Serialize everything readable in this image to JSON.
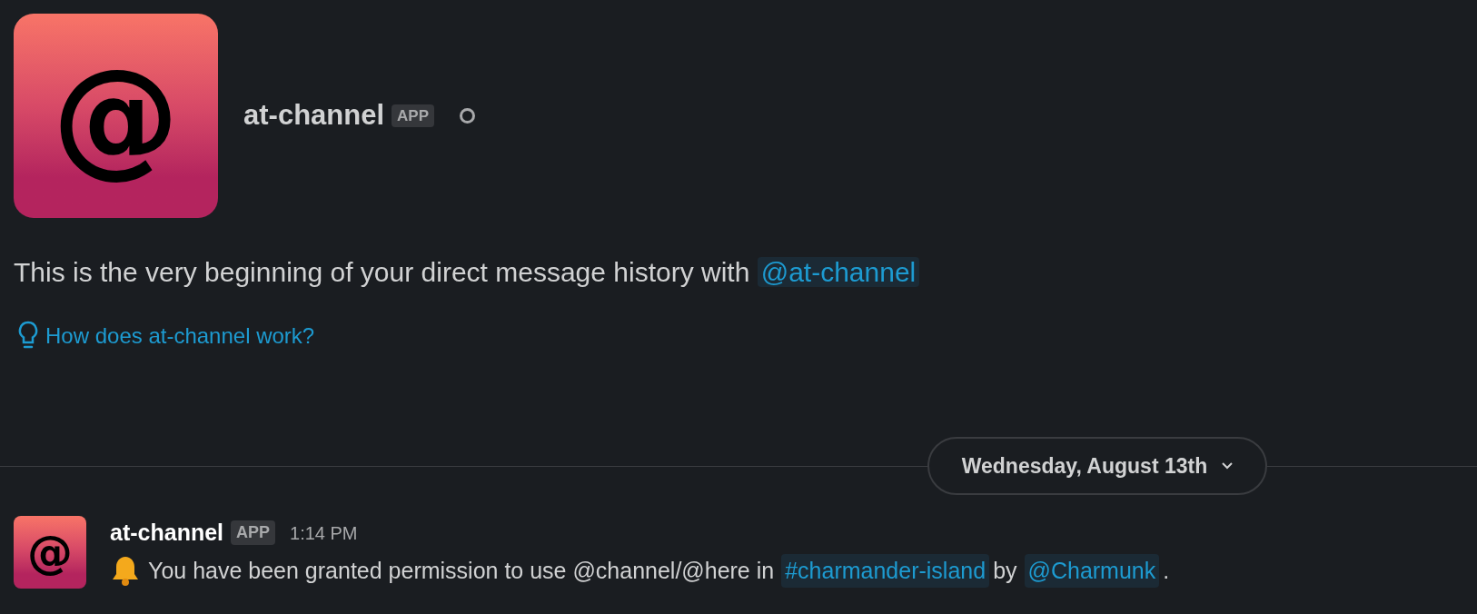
{
  "profile": {
    "logo_glyph": "@",
    "name": "at-channel",
    "badge": "APP",
    "active": false
  },
  "intro": {
    "text": "This is the very beginning of your direct message history with",
    "mention": "@at-channel"
  },
  "help_link": "How does at-channel work?",
  "date_divider": {
    "label": "Wednesday, August 13th"
  },
  "messages": [
    {
      "author": "at-channel",
      "logo_glyph": "@",
      "badge": "APP",
      "time": "1:14 PM",
      "parts": [
        {
          "kind": "text",
          "text": "You have been granted permission to use @channel/@here in"
        },
        {
          "kind": "mention",
          "text": "#charmander-island"
        },
        {
          "kind": "text",
          "text": "by"
        },
        {
          "kind": "mention",
          "text": "@Charmunk"
        },
        {
          "kind": "text",
          "text": "."
        }
      ]
    }
  ]
}
